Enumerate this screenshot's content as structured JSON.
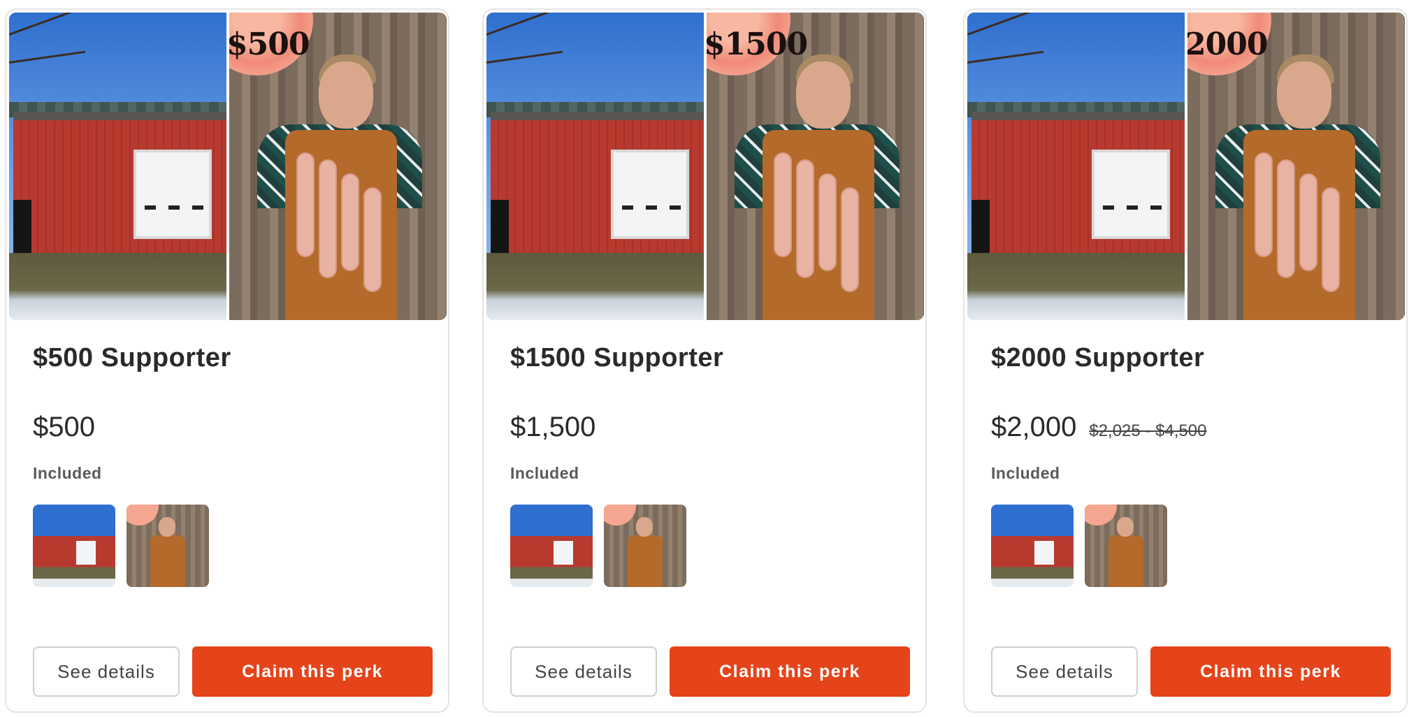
{
  "perks": [
    {
      "title": "$500 Supporter",
      "price": "$500",
      "original_price": "",
      "included_label": "Included",
      "image_price_tag": "$500",
      "see_details_label": "See details",
      "claim_label": "Claim this perk"
    },
    {
      "title": "$1500 Supporter",
      "price": "$1,500",
      "original_price": "",
      "included_label": "Included",
      "image_price_tag": "$1500",
      "see_details_label": "See details",
      "claim_label": "Claim this perk"
    },
    {
      "title": "$2000 Supporter",
      "price": "$2,000",
      "original_price": "$2,025 - $4,500",
      "included_label": "Included",
      "image_price_tag": "2000",
      "see_details_label": "See details",
      "claim_label": "Claim this perk"
    }
  ],
  "colors": {
    "claim_button": "#e5431a",
    "text": "#2a2a2a",
    "card_border": "#e4e4e4"
  }
}
